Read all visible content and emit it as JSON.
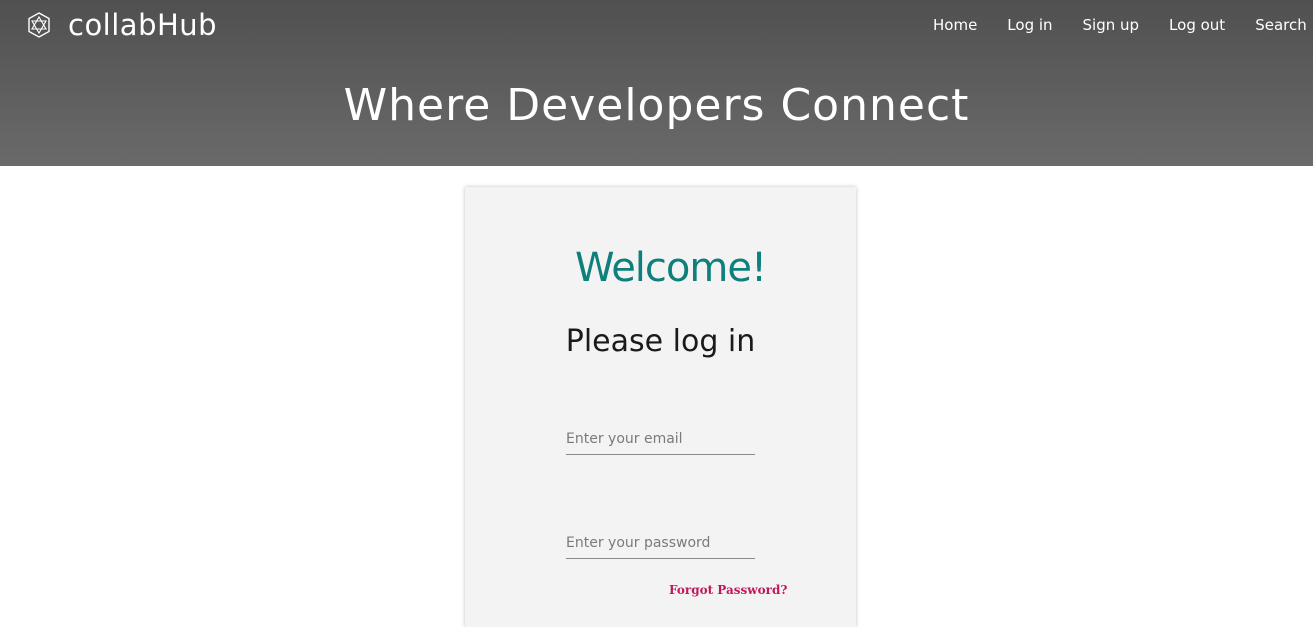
{
  "brand": {
    "name": "collabHub",
    "icon": "polygon-logo-icon"
  },
  "nav": {
    "items": [
      {
        "label": "Home"
      },
      {
        "label": "Log in"
      },
      {
        "label": "Sign up"
      },
      {
        "label": "Log out"
      },
      {
        "label": "Search"
      }
    ]
  },
  "hero": {
    "title": "Where Developers Connect"
  },
  "login": {
    "welcome": "Welcome!",
    "subtitle": "Please log in",
    "email_placeholder": "Enter your email",
    "email_value": "",
    "password_placeholder": "Enter your password",
    "password_value": "",
    "forgot_label": "Forgot Password?"
  },
  "colors": {
    "header_top": "#505050",
    "header_bottom": "#6a6a6a",
    "welcome": "#0f7f7b",
    "forgot_link": "#c2185b",
    "card_bg": "#f3f3f3"
  }
}
